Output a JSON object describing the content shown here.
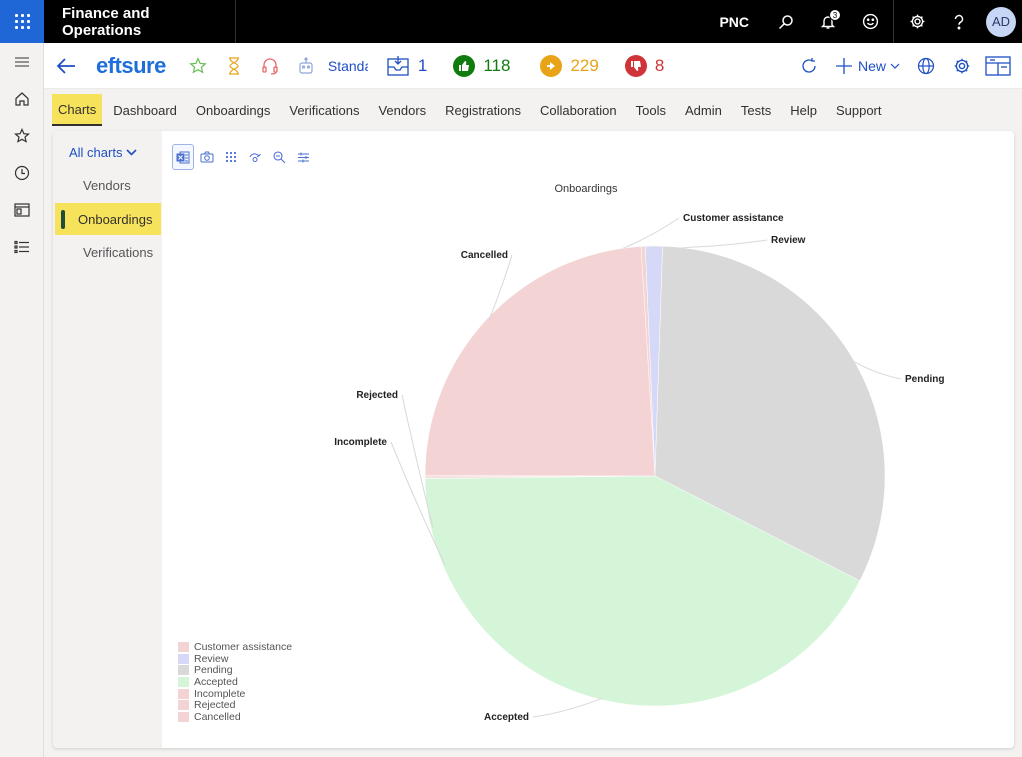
{
  "app": {
    "title": "Finance and Operations",
    "company": "PNC",
    "notification_count": "3",
    "user_initials": "AD"
  },
  "actionbar": {
    "brand": "eftsure",
    "standard_label": "Standard",
    "metrics": [
      {
        "name": "inbox",
        "value": "1",
        "color": "#1e4fc4"
      },
      {
        "name": "approved",
        "value": "118",
        "color": "#107c10"
      },
      {
        "name": "pending",
        "value": "229",
        "color": "#e8a317"
      },
      {
        "name": "rejected",
        "value": "8",
        "color": "#d13438"
      }
    ],
    "new_label": "New"
  },
  "menu": [
    {
      "label": "Charts",
      "active": true
    },
    {
      "label": "Dashboard"
    },
    {
      "label": "Onboardings"
    },
    {
      "label": "Verifications"
    },
    {
      "label": "Vendors"
    },
    {
      "label": "Registrations"
    },
    {
      "label": "Collaboration"
    },
    {
      "label": "Tools"
    },
    {
      "label": "Admin"
    },
    {
      "label": "Tests"
    },
    {
      "label": "Help"
    },
    {
      "label": "Support"
    }
  ],
  "subnav": {
    "all_charts": "All charts",
    "items": [
      {
        "label": "Vendors"
      },
      {
        "label": "Onboardings",
        "active": true
      },
      {
        "label": "Verifications"
      }
    ]
  },
  "chart_data": {
    "type": "pie",
    "title": "Onboardings",
    "legend_position": "bottom-left",
    "slices": [
      {
        "label": "Customer assistance",
        "value": 0.3,
        "color": "#f4d3d5"
      },
      {
        "label": "Review",
        "value": 1.2,
        "color": "#d5d9f7"
      },
      {
        "label": "Pending",
        "value": 32.0,
        "color": "#d9d9d9"
      },
      {
        "label": "Accepted",
        "value": 42.3,
        "color": "#d5f5d8"
      },
      {
        "label": "Incomplete",
        "value": 0.1,
        "color": "#f4d3d5"
      },
      {
        "label": "Rejected",
        "value": 0.1,
        "color": "#f4d3d5"
      },
      {
        "label": "Cancelled",
        "value": 24.0,
        "color": "#f4d3d5"
      }
    ]
  }
}
